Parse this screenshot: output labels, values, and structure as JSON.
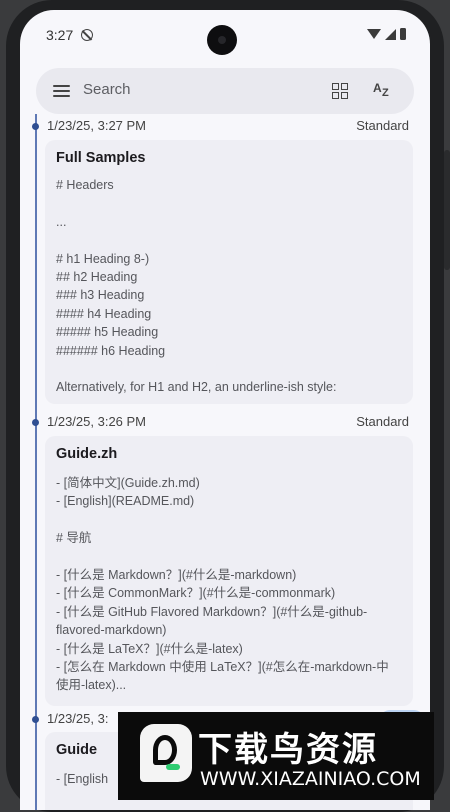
{
  "status_bar": {
    "time": "3:27",
    "icons": [
      "do-not-disturb-icon",
      "wifi-icon",
      "signal-icon",
      "battery-icon"
    ]
  },
  "search": {
    "placeholder": "Search",
    "icons": [
      "menu-icon",
      "grid-view-icon",
      "sort-az-icon"
    ]
  },
  "notes": [
    {
      "date": "1/23/25, 3:27 PM",
      "type": "Standard",
      "title": "Full Samples",
      "body": "# Headers\n\n...\n\n# h1 Heading 8-)\n## h2 Heading\n### h3 Heading\n#### h4 Heading\n##### h5 Heading\n###### h6 Heading\n\nAlternatively, for H1 and H2, an underline-ish style:\n..."
    },
    {
      "date": "1/23/25, 3:26 PM",
      "type": "Standard",
      "title": "Guide.zh",
      "body": "- [简体中文](Guide.zh.md)\n- [English](README.md)\n\n# 导航\n\n- [什么是 Markdown？](#什么是-markdown)\n- [什么是 CommonMark？](#什么是-commonmark)\n- [什么是 GitHub Flavored Markdown？](#什么是-github-flavored-markdown)\n- [什么是 LaTeX？](#什么是-latex)\n- [怎么在 Markdown 中使用 LaTeX？](#怎么在-markdown-中使用-latex)..."
    },
    {
      "date": "1/23/25, 3:",
      "type": "",
      "title": "Guide",
      "body": "- [English"
    }
  ],
  "watermark": {
    "title": "下载鸟资源",
    "url": "WWW.XIAZAINIAO.COM"
  },
  "colors": {
    "accent": "#2f4f92",
    "background": "#f7f7fb",
    "card": "#eeeef4"
  }
}
